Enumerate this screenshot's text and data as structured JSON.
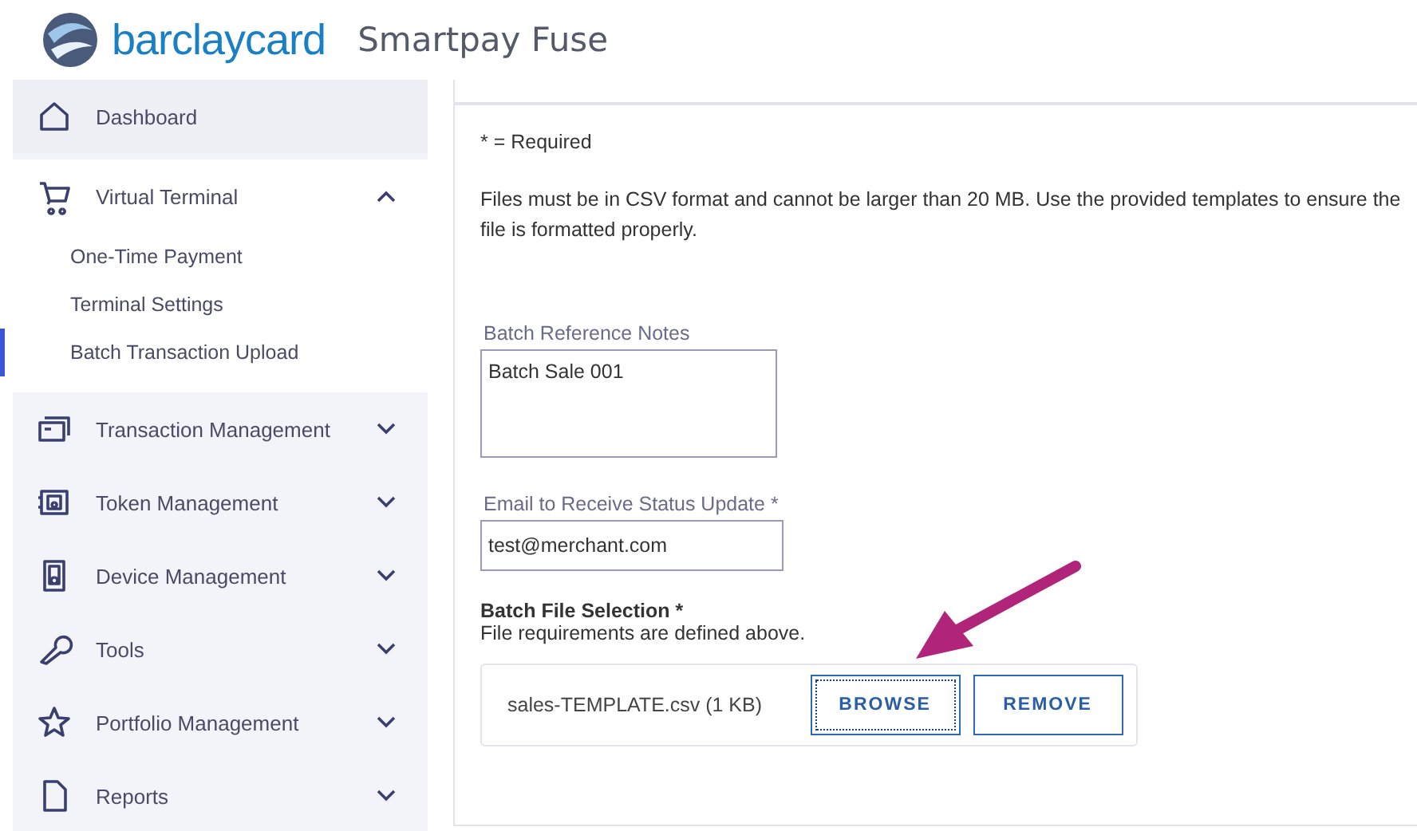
{
  "header": {
    "brand": "barclaycard",
    "product": "Smartpay Fuse"
  },
  "sidebar": {
    "items": [
      {
        "label": "Dashboard"
      },
      {
        "label": "Virtual Terminal",
        "expanded": true,
        "children": [
          {
            "label": "One-Time Payment",
            "selected": false
          },
          {
            "label": "Terminal Settings",
            "selected": false
          },
          {
            "label": "Batch Transaction Upload",
            "selected": true
          }
        ]
      },
      {
        "label": "Transaction Management",
        "expanded": false
      },
      {
        "label": "Token Management",
        "expanded": false
      },
      {
        "label": "Device Management",
        "expanded": false
      },
      {
        "label": "Tools",
        "expanded": false
      },
      {
        "label": "Portfolio Management",
        "expanded": false
      },
      {
        "label": "Reports",
        "expanded": false
      }
    ]
  },
  "form": {
    "required_note": "* = Required",
    "info": "Files must be in CSV format and cannot be larger than 20 MB. Use the provided templates to ensure the file is formatted properly.",
    "notes_field": {
      "label": "Batch Reference Notes",
      "value": "Batch Sale 001"
    },
    "email_field": {
      "label": "Email to Receive Status Update *",
      "value": "test@merchant.com"
    },
    "file_section": {
      "title": "Batch File Selection *",
      "hint": "File requirements are defined above.",
      "file": "sales-TEMPLATE.csv (1 KB)",
      "buttons": [
        {
          "label": "BROWSE",
          "focused": true
        },
        {
          "label": "REMOVE",
          "focused": false
        }
      ]
    }
  }
}
